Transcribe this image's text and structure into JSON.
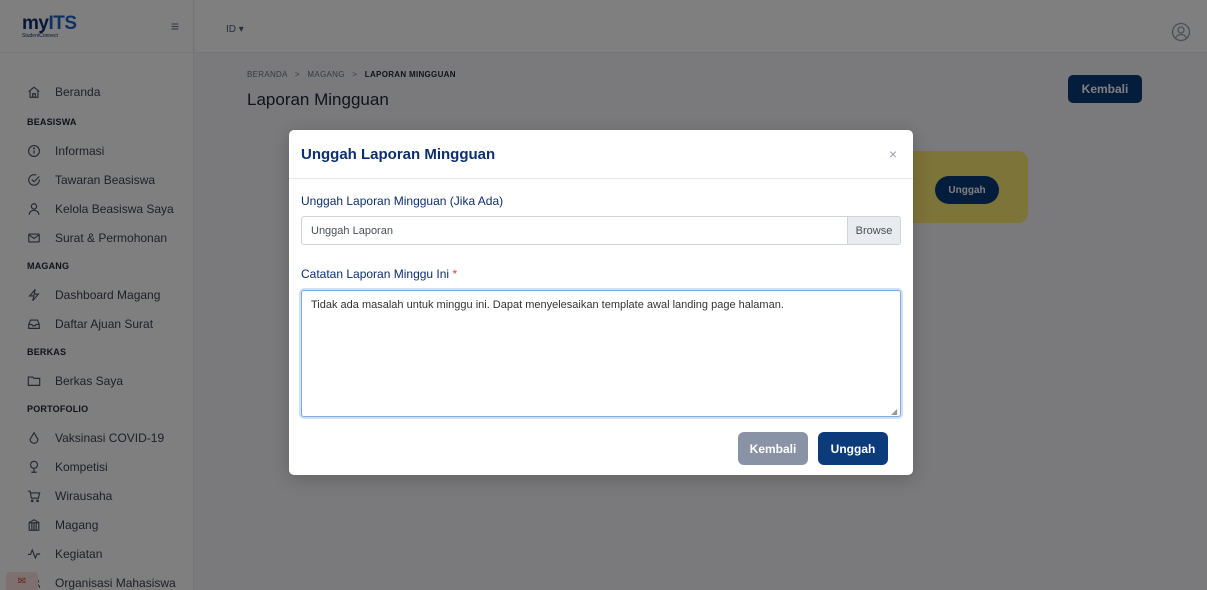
{
  "app": {
    "logo_text": "myITS",
    "logo_subtext": "StudentConnect",
    "language": "ID ▾"
  },
  "sidebar": {
    "home": "Beranda",
    "sections": [
      {
        "title": "BEASISWA",
        "items": [
          {
            "label": "Informasi",
            "icon": "info-icon"
          },
          {
            "label": "Tawaran Beasiswa",
            "icon": "check-circle-icon"
          },
          {
            "label": "Kelola Beasiswa Saya",
            "icon": "user-icon"
          },
          {
            "label": "Surat & Permohonan",
            "icon": "mail-icon"
          }
        ]
      },
      {
        "title": "MAGANG",
        "items": [
          {
            "label": "Dashboard Magang",
            "icon": "lightning-icon"
          },
          {
            "label": "Daftar Ajuan Surat",
            "icon": "inbox-icon"
          }
        ]
      },
      {
        "title": "BERKAS",
        "items": [
          {
            "label": "Berkas Saya",
            "icon": "folder-icon"
          }
        ]
      },
      {
        "title": "PORTOFOLIO",
        "items": [
          {
            "label": "Vaksinasi COVID-19",
            "icon": "drop-icon"
          },
          {
            "label": "Kompetisi",
            "icon": "trophy-icon"
          },
          {
            "label": "Wirausaha",
            "icon": "cart-icon"
          },
          {
            "label": "Magang",
            "icon": "building-icon"
          },
          {
            "label": "Kegiatan",
            "icon": "activity-icon"
          },
          {
            "label": "Organisasi Mahasiswa",
            "icon": "group-icon"
          }
        ]
      }
    ]
  },
  "page": {
    "breadcrumb": [
      "BERANDA",
      "MAGANG",
      "LAPORAN MINGGUAN"
    ],
    "breadcrumb_separator": ">",
    "title": "Laporan Mingguan",
    "back_button": "Kembali",
    "card_button": "Unggah"
  },
  "modal": {
    "title": "Unggah Laporan Mingguan",
    "close_symbol": "×",
    "upload_label": "Unggah Laporan Mingguan (Jika Ada)",
    "upload_placeholder": "Unggah Laporan",
    "browse_label": "Browse",
    "notes_label": "Catatan Laporan Minggu Ini",
    "required_mark": "*",
    "notes_value": "Tidak ada masalah untuk minggu ini. Dapat menyelesaikan template awal landing page halaman.",
    "cancel_button": "Kembali",
    "submit_button": "Unggah"
  },
  "colors": {
    "primary": "#0b3b7a",
    "secondary_button": "#8a93a6",
    "card_yellow": "#fbe873",
    "required": "#e0393e",
    "label": "#0d2f6e"
  }
}
